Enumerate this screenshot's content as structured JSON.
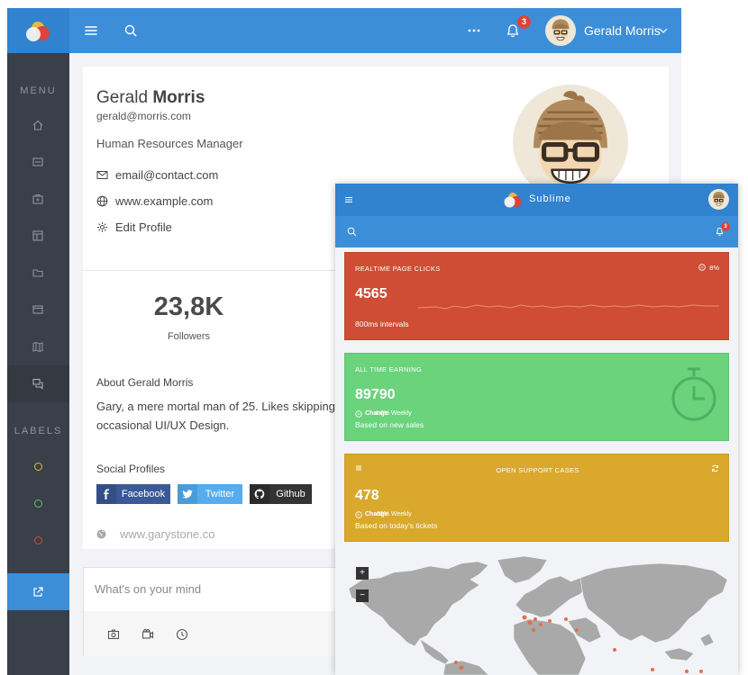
{
  "desktop": {
    "topbar": {
      "notifications_count": "3",
      "username": "Gerald Morris"
    },
    "sidebar": {
      "menu_heading": "MENU",
      "labels_heading": "LABELS",
      "label_colors": [
        "#e6b93a",
        "#5fbf6a",
        "#d9453b"
      ]
    },
    "profile": {
      "first_name": "Gerald",
      "last_name": "Morris",
      "email": "gerald@morris.com",
      "role": "Human Resources Manager",
      "contact_email": "email@contact.com",
      "website": "www.example.com",
      "edit_profile": "Edit Profile",
      "followers_count": "23,8K",
      "followers_label": "Followers",
      "about_title": "About Gerald Morris",
      "about_text": "Gary, a mere mortal man of 25. Likes skipping occasional UI/UX Design.",
      "social_title": "Social Profiles",
      "social": {
        "facebook": "Facebook",
        "twitter": "Twitter",
        "github": "Github"
      },
      "website_footer": "www.garystone.co"
    },
    "composer": {
      "placeholder": "What's on your mind"
    }
  },
  "mobile": {
    "app_name": "Sublime",
    "notifications_count": "3",
    "tiles": {
      "realtime": {
        "title": "REALTIME PAGE CLICKS",
        "percent": "8%",
        "value": "4565",
        "subtitle": "800ms intervals"
      },
      "earning": {
        "title": "ALL TIME EARNING",
        "value": "89790",
        "change_pct": "4.6% Weekly",
        "change_word": "Change",
        "subtitle": "Based on new sales"
      },
      "support": {
        "title": "OPEN SUPPORT CASES",
        "value": "478",
        "change_pct": ".65% Weekly",
        "change_word": "Change",
        "subtitle": "Based on today's tickets"
      }
    },
    "map": {
      "zoom_in": "+",
      "zoom_out": "−"
    }
  },
  "colors": {
    "primary_blue": "#3d8ed8",
    "sidebar": "#3a4049",
    "tile_red": "#cf4d34",
    "tile_green": "#6ad37c",
    "tile_yellow": "#d9a82c",
    "facebook": "#3b5998",
    "twitter": "#55acee",
    "github": "#333333",
    "badge_red": "#d9453b"
  }
}
